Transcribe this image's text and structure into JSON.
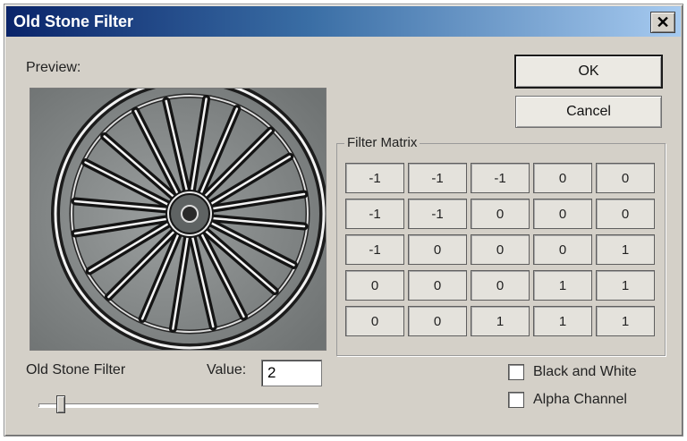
{
  "window": {
    "title": "Old Stone Filter",
    "close_glyph": "✕"
  },
  "preview": {
    "label": "Preview:"
  },
  "buttons": {
    "ok": "OK",
    "cancel": "Cancel"
  },
  "filter_matrix": {
    "title": "Filter Matrix",
    "rows": [
      [
        "-1",
        "-1",
        "-1",
        "0",
        "0"
      ],
      [
        "-1",
        "-1",
        "0",
        "0",
        "0"
      ],
      [
        "-1",
        "0",
        "0",
        "0",
        "1"
      ],
      [
        "0",
        "0",
        "0",
        "1",
        "1"
      ],
      [
        "0",
        "0",
        "1",
        "1",
        "1"
      ]
    ]
  },
  "filter_control": {
    "label": "Old Stone Filter",
    "value_label": "Value:",
    "value": "2",
    "slider_position": 0.07
  },
  "options": {
    "black_and_white": {
      "label": "Black and White",
      "checked": false
    },
    "alpha_channel": {
      "label": "Alpha Channel",
      "checked": false
    }
  },
  "colors": {
    "titlebar_start": "#0a246a",
    "titlebar_end": "#a6caf0",
    "dialog_bg": "#d4d0c8"
  }
}
